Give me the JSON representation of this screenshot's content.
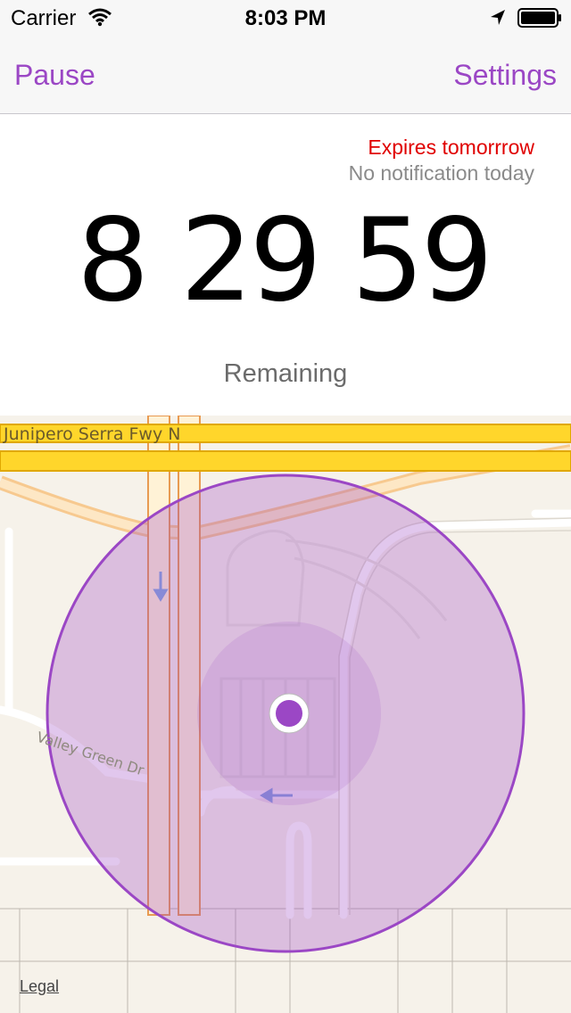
{
  "status_bar": {
    "carrier": "Carrier",
    "time": "8:03 PM",
    "icons": [
      "wifi-icon",
      "location-arrow-icon",
      "battery-icon"
    ]
  },
  "nav": {
    "left_button": "Pause",
    "right_button": "Settings",
    "accent_color": "#9b47c5"
  },
  "info": {
    "expires": "Expires tomorrrow",
    "notification": "No notification today",
    "expires_color": "#e00000"
  },
  "countdown": {
    "hours": "8",
    "minutes": "29",
    "seconds": "59",
    "label": "Remaining"
  },
  "map": {
    "highway_label": "Junipero Serra Fwy N",
    "street_label": "Valley Green Dr",
    "legal": "Legal",
    "region_color": "#9b47c5"
  }
}
